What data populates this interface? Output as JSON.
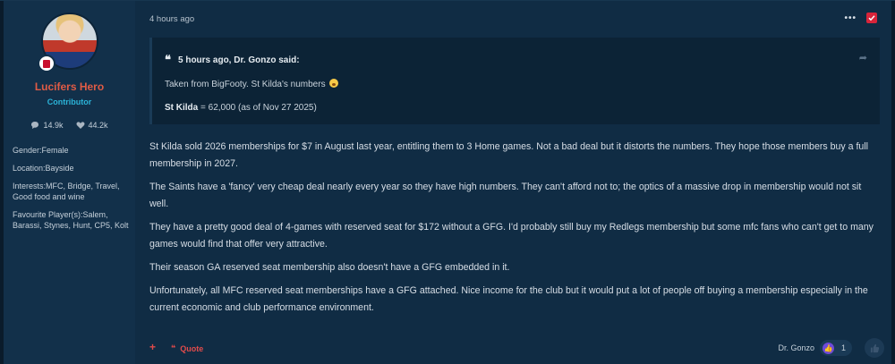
{
  "user": {
    "name": "Lucifers Hero",
    "title": "Contributor",
    "posts_count": "14.9k",
    "reactions_count": "44.2k",
    "fields": [
      "Gender:Female",
      "Location:Bayside",
      "Interests:MFC, Bridge, Travel, Good food and wine",
      "Favourite Player(s):Salem, Barassi, Stynes, Hunt, CP5, Kolt"
    ]
  },
  "post": {
    "timestamp": "4 hours ago",
    "share_label": "•••",
    "quote": {
      "attribution": "5 hours ago, Dr. Gonzo said:",
      "line1": "Taken from BigFooty. St Kilda's numbers",
      "line2_bold": "St Kilda",
      "line2_rest": " = 62,000 (as of Nov 27 2025)"
    },
    "paragraphs": [
      "St Kilda sold 2026 memberships for $7 in August last year, entitling them to 3 Home games. Not a bad deal but it distorts the numbers. They hope those members buy a full membership in 2027.",
      "The Saints have a 'fancy' very cheap deal nearly every year so they have high numbers. They can't afford not to; the optics of a massive drop in membership would not sit well.",
      "They have a pretty good deal of 4-games with reserved seat for $172 without a GFG. I'd probably still buy my Redlegs membership but some mfc fans who can't get to many games would find that offer very attractive.",
      "Their season GA reserved seat membership also doesn't have a GFG embedded in it.",
      "Unfortunately, all MFC reserved seat memberships have a GFG attached. Nice income for the club but it would put a lot of people off buying a membership especially in the current economic and club performance environment."
    ]
  },
  "footer": {
    "plus_label": "+",
    "quote_label": "Quote",
    "reaction_user": "Dr. Gonzo",
    "reaction_count": "1"
  },
  "colors": {
    "accent_red": "#e04b4b",
    "title_cyan": "#2bb3d8",
    "username_orange": "#e05b45"
  }
}
